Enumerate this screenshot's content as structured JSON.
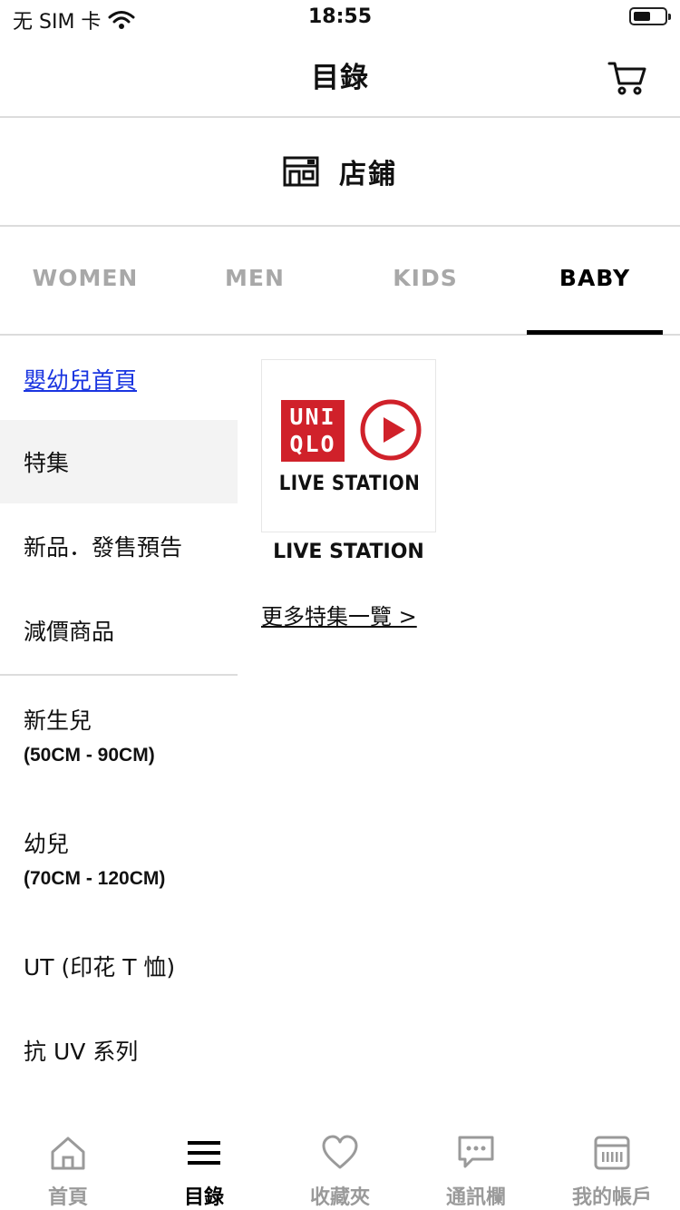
{
  "status_bar": {
    "carrier": "无 SIM 卡",
    "time": "18:55",
    "battery_level": 0.55
  },
  "header": {
    "title": "目錄",
    "cart_icon": "cart-icon"
  },
  "store": {
    "label": "店鋪",
    "icon": "store-icon"
  },
  "gender_tabs": [
    {
      "label": "WOMEN",
      "active": false
    },
    {
      "label": "MEN",
      "active": false
    },
    {
      "label": "KIDS",
      "active": false
    },
    {
      "label": "BABY",
      "active": true
    }
  ],
  "sidebar": {
    "home_link": "嬰幼兒首頁",
    "menu": [
      {
        "label": "特集",
        "active": true
      },
      {
        "label": "新品．發售預告",
        "active": false
      },
      {
        "label": "減價商品",
        "active": false
      }
    ],
    "categories": [
      {
        "title": "新生兒",
        "subtitle": "(50CM - 90CM)"
      },
      {
        "title": "幼兒",
        "subtitle": "(70CM - 120CM)"
      },
      {
        "title": "UT (印花 T 恤)",
        "subtitle": ""
      },
      {
        "title": "抗 UV 系列",
        "subtitle": ""
      }
    ]
  },
  "feature": {
    "logo_lines": [
      "UNI",
      "QLO"
    ],
    "logo_caption": "LIVE STATION",
    "label": "LIVE STATION",
    "more_link": "更多特集一覽 >",
    "brand_color": "#d0212a"
  },
  "tab_bar": [
    {
      "label": "首頁",
      "icon": "home-icon",
      "active": false
    },
    {
      "label": "目錄",
      "icon": "menu-icon",
      "active": true
    },
    {
      "label": "收藏夾",
      "icon": "heart-icon",
      "active": false
    },
    {
      "label": "通訊欄",
      "icon": "chat-icon",
      "active": false
    },
    {
      "label": "我的帳戶",
      "icon": "membership-card-icon",
      "active": false
    }
  ]
}
